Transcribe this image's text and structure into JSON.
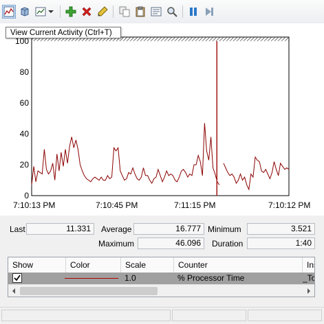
{
  "tooltip": {
    "text": "View Current Activity (Ctrl+T)"
  },
  "toolbar": {
    "buttons": [
      {
        "name": "view-current-activity-button",
        "icon": "graph-icon"
      },
      {
        "name": "view-log-data-button",
        "icon": "database-icon"
      },
      {
        "name": "change-graph-type-button",
        "icon": "chart-type-icon"
      },
      {
        "name": "graph-type-dropdown",
        "icon": "chevron-down-icon"
      },
      {
        "name": "add-counter-button",
        "icon": "add-icon"
      },
      {
        "name": "delete-counter-button",
        "icon": "delete-icon"
      },
      {
        "name": "highlight-button",
        "icon": "highlighter-icon"
      },
      {
        "name": "copy-properties-button",
        "icon": "copy-icon"
      },
      {
        "name": "paste-counter-list-button",
        "icon": "paste-icon"
      },
      {
        "name": "properties-button",
        "icon": "properties-icon"
      },
      {
        "name": "zoom-button",
        "icon": "magnifier-icon"
      },
      {
        "name": "freeze-display-button",
        "icon": "pause-icon"
      },
      {
        "name": "update-data-button",
        "icon": "step-icon"
      }
    ]
  },
  "chart_data": {
    "type": "line",
    "ylim": [
      0,
      100
    ],
    "yticks": [
      "100",
      "80",
      "60",
      "40",
      "20",
      "0"
    ],
    "xticks": [
      "7:10:13 PM",
      "7:10:45 PM",
      "7:11:15 PM",
      "7:10:12 PM"
    ],
    "series": [
      {
        "color": "#8b0000",
        "values": [
          7,
          19,
          9,
          16,
          15,
          14,
          30,
          17,
          14,
          16,
          21,
          10,
          27,
          16,
          28,
          19,
          30,
          21,
          32,
          38,
          31,
          36,
          30,
          20,
          16,
          13,
          11,
          10,
          9,
          11,
          12,
          11,
          10,
          12,
          10,
          10,
          13,
          11,
          12,
          31,
          29,
          31,
          16,
          13,
          10,
          11,
          15,
          14,
          18,
          14,
          11,
          10,
          12,
          18,
          13,
          13,
          10,
          8,
          11,
          12,
          17,
          13,
          9,
          12,
          16,
          13,
          14,
          13,
          10,
          9,
          12,
          16,
          17,
          15,
          12,
          14,
          13,
          20,
          20,
          26,
          22,
          13,
          47,
          29,
          23,
          38,
          18,
          14,
          9,
          7,
          null,
          21,
          18,
          15,
          13,
          14,
          12,
          8,
          10,
          14,
          10,
          12,
          7,
          4,
          14,
          12,
          25,
          23,
          22,
          16,
          15,
          17,
          14,
          11,
          15,
          22,
          17,
          13,
          21,
          19,
          17,
          18,
          17
        ]
      }
    ],
    "current_position": 0.72,
    "stats": {
      "last_label": "Last",
      "last": "11.331",
      "average_label": "Average",
      "average": "16.777",
      "minimum_label": "Minimum",
      "minimum": "3.521",
      "maximum_label": "Maximum",
      "maximum": "46.096",
      "duration_label": "Duration",
      "duration": "1:40"
    }
  },
  "counters": {
    "headers": {
      "show": "Show",
      "color": "Color",
      "scale": "Scale",
      "counter": "Counter",
      "instance": "Inst"
    },
    "rows": [
      {
        "show": true,
        "color": "#b30000",
        "scale": "1.0",
        "counter": "% Processor Time",
        "instance": "_To"
      }
    ]
  }
}
